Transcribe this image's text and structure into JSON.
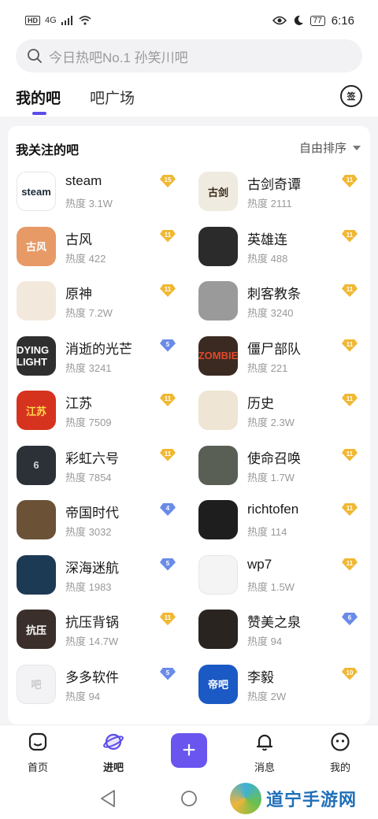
{
  "status_bar": {
    "left_badge": "HD",
    "network": "4G",
    "battery": "77",
    "time": "6:16"
  },
  "search": {
    "placeholder": "今日热吧No.1 孙笑川吧"
  },
  "tabs": [
    {
      "label": "我的吧",
      "active": true
    },
    {
      "label": "吧广场",
      "active": false
    }
  ],
  "sign_button": "签",
  "section": {
    "title": "我关注的吧",
    "sort_label": "自由排序"
  },
  "colors": {
    "accent": "#5b4de8",
    "level_gold": "#f0b833",
    "level_blue": "#6a8be8"
  },
  "forums": [
    {
      "name": "steam",
      "heat": "热度 3.1W",
      "level": "15",
      "level_color": "gold",
      "avatar_bg": "#ffffff",
      "avatar_fg": "#1b2838",
      "avatar_text": "steam"
    },
    {
      "name": "古剑奇谭",
      "heat": "热度 2111",
      "level": "11",
      "level_color": "gold",
      "avatar_bg": "#f0ebe0",
      "avatar_fg": "#3a2a1a",
      "avatar_text": "古剑"
    },
    {
      "name": "古风",
      "heat": "热度 422",
      "level": "11",
      "level_color": "gold",
      "avatar_bg": "#e79a66",
      "avatar_fg": "#ffffff",
      "avatar_text": "古风"
    },
    {
      "name": "英雄连",
      "heat": "热度 488",
      "level": "11",
      "level_color": "gold",
      "avatar_bg": "#2b2b2b",
      "avatar_fg": "#dddddd",
      "avatar_text": ""
    },
    {
      "name": "原神",
      "heat": "热度 7.2W",
      "level": "11",
      "level_color": "gold",
      "avatar_bg": "#f3e8dc",
      "avatar_fg": "#555555",
      "avatar_text": ""
    },
    {
      "name": "刺客教条",
      "heat": "热度 3240",
      "level": "11",
      "level_color": "gold",
      "avatar_bg": "#9a9a9a",
      "avatar_fg": "#ffffff",
      "avatar_text": ""
    },
    {
      "name": "消逝的光芒",
      "heat": "热度 3241",
      "level": "5",
      "level_color": "blue",
      "avatar_bg": "#2f2f2f",
      "avatar_fg": "#ffffff",
      "avatar_text": "DYING LIGHT"
    },
    {
      "name": "僵尸部队",
      "heat": "热度 221",
      "level": "11",
      "level_color": "gold",
      "avatar_bg": "#3a2a22",
      "avatar_fg": "#e04a2a",
      "avatar_text": "ZOMBIE"
    },
    {
      "name": "江苏",
      "heat": "热度 7509",
      "level": "11",
      "level_color": "gold",
      "avatar_bg": "#d6331f",
      "avatar_fg": "#ffd94a",
      "avatar_text": "江苏"
    },
    {
      "name": "历史",
      "heat": "热度 2.3W",
      "level": "11",
      "level_color": "gold",
      "avatar_bg": "#efe5d4",
      "avatar_fg": "#6b3a1e",
      "avatar_text": ""
    },
    {
      "name": "彩虹六号",
      "heat": "热度 7854",
      "level": "11",
      "level_color": "gold",
      "avatar_bg": "#2c3138",
      "avatar_fg": "#cfd4da",
      "avatar_text": "6"
    },
    {
      "name": "使命召唤",
      "heat": "热度 1.7W",
      "level": "11",
      "level_color": "gold",
      "avatar_bg": "#5a5f55",
      "avatar_fg": "#ffffff",
      "avatar_text": ""
    },
    {
      "name": "帝国时代",
      "heat": "热度 3032",
      "level": "4",
      "level_color": "blue",
      "avatar_bg": "#6b5237",
      "avatar_fg": "#ffffff",
      "avatar_text": ""
    },
    {
      "name": "richtofen",
      "heat": "热度 114",
      "level": "11",
      "level_color": "gold",
      "avatar_bg": "#1e1e1e",
      "avatar_fg": "#ffffff",
      "avatar_text": ""
    },
    {
      "name": "深海迷航",
      "heat": "热度 1983",
      "level": "5",
      "level_color": "blue",
      "avatar_bg": "#1d3a55",
      "avatar_fg": "#ffffff",
      "avatar_text": ""
    },
    {
      "name": "wp7",
      "heat": "热度 1.5W",
      "level": "11",
      "level_color": "gold",
      "avatar_bg": "#f4f4f4",
      "avatar_fg": "#333333",
      "avatar_text": ""
    },
    {
      "name": "抗压背锅",
      "heat": "热度 14.7W",
      "level": "11",
      "level_color": "gold",
      "avatar_bg": "#3a2f2a",
      "avatar_fg": "#ffffff",
      "avatar_text": "抗压"
    },
    {
      "name": "赞美之泉",
      "heat": "热度 94",
      "level": "6",
      "level_color": "blue",
      "avatar_bg": "#2a2420",
      "avatar_fg": "#e0c690",
      "avatar_text": ""
    },
    {
      "name": "多多软件",
      "heat": "热度 94",
      "level": "5",
      "level_color": "blue",
      "avatar_bg": "#f3f3f5",
      "avatar_fg": "#c8c8cc",
      "avatar_text": "吧"
    },
    {
      "name": "李毅",
      "heat": "热度 2W",
      "level": "10",
      "level_color": "gold",
      "avatar_bg": "#1b59c4",
      "avatar_fg": "#ffffff",
      "avatar_text": "帝吧"
    }
  ],
  "bottom_nav": [
    {
      "label": "首页",
      "icon": "home-icon",
      "active": false
    },
    {
      "label": "进吧",
      "icon": "planet-icon",
      "active": true
    },
    {
      "label": "",
      "icon": "plus-icon",
      "active": false
    },
    {
      "label": "消息",
      "icon": "bell-icon",
      "active": false
    },
    {
      "label": "我的",
      "icon": "smiley-icon",
      "active": false
    }
  ],
  "watermark": {
    "text": "道宁手游网"
  }
}
